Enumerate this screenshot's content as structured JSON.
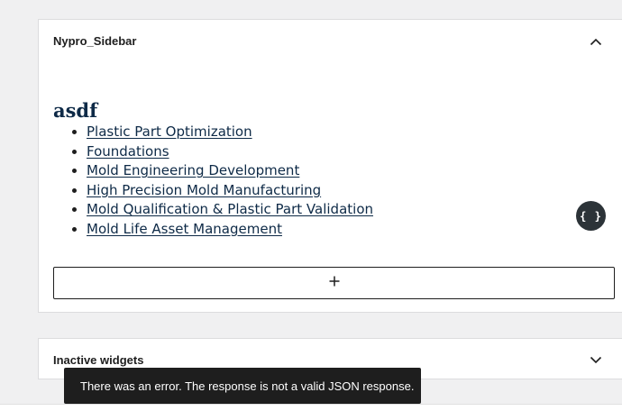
{
  "widget_area": {
    "title": "Nypro_Sidebar",
    "toggle_icon": "chevron-up-icon"
  },
  "block": {
    "heading": "asdf",
    "list_items": [
      "Plastic Part Optimization",
      "Foundations",
      "Mold Engineering Development",
      "High Precision Mold Manufacturing",
      "Mold Qualification & Plastic Part Validation",
      "Mold Life Asset Management"
    ],
    "link_color": "#0e2a47"
  },
  "add_block": {
    "icon": "plus-icon"
  },
  "code_button": {
    "label": "{ }",
    "color": "#2c3338"
  },
  "inactive_widgets": {
    "title": "Inactive widgets",
    "toggle_icon": "chevron-down-icon"
  },
  "notice": {
    "message": "There was an error. The response is not a valid JSON response.",
    "color": "#1e1e1e"
  }
}
